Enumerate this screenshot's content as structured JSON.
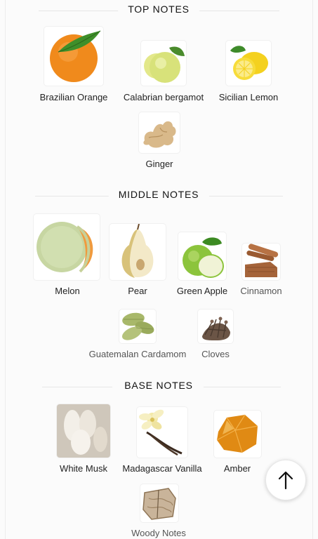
{
  "sections": {
    "top": {
      "title": "TOP NOTES",
      "notes": [
        {
          "name": "Brazilian Orange",
          "icon": "orange-icon"
        },
        {
          "name": "Calabrian bergamot",
          "icon": "bergamot-icon"
        },
        {
          "name": "Sicilian Lemon",
          "icon": "lemon-icon"
        },
        {
          "name": "Ginger",
          "icon": "ginger-icon"
        }
      ]
    },
    "middle": {
      "title": "MIDDLE NOTES",
      "notes": [
        {
          "name": "Melon",
          "icon": "melon-icon"
        },
        {
          "name": "Pear",
          "icon": "pear-icon"
        },
        {
          "name": "Green Apple",
          "icon": "green-apple-icon"
        },
        {
          "name": "Cinnamon",
          "icon": "cinnamon-icon"
        },
        {
          "name": "Guatemalan Cardamom",
          "icon": "cardamom-icon"
        },
        {
          "name": "Cloves",
          "icon": "cloves-icon"
        }
      ]
    },
    "base": {
      "title": "BASE NOTES",
      "notes": [
        {
          "name": "White Musk",
          "icon": "white-musk-icon"
        },
        {
          "name": "Madagascar Vanilla",
          "icon": "vanilla-icon"
        },
        {
          "name": "Amber",
          "icon": "amber-icon"
        },
        {
          "name": "Woody Notes",
          "icon": "woody-icon"
        }
      ]
    }
  },
  "scroll_top_button": {
    "icon": "arrow-up-icon"
  }
}
